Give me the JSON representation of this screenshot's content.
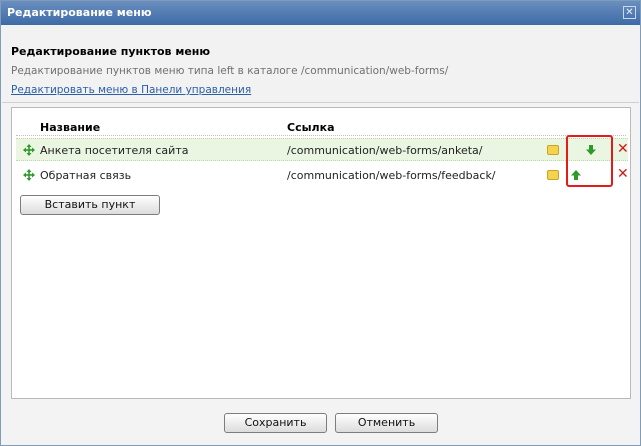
{
  "dialog": {
    "title": "Редактирование меню",
    "close_glyph": "✕"
  },
  "header": {
    "title": "Редактирование пунктов меню",
    "description": "Редактирование пунктов меню типа left в каталоге /communication/web-forms/",
    "link": "Редактировать меню в Панели управления"
  },
  "table": {
    "columns": [
      "Название",
      "Ссылка"
    ],
    "rows": [
      {
        "name": "Анкета посетителя сайта",
        "link": "/communication/web-forms/anketa/",
        "arrow": "down"
      },
      {
        "name": "Обратная связь",
        "link": "/communication/web-forms/feedback/",
        "arrow": "up"
      }
    ],
    "insert_button": "Вставить пункт",
    "delete_glyph": "✕"
  },
  "footer": {
    "save_label": "Сохранить",
    "cancel_label": "Отменить"
  },
  "colors": {
    "titlebar": "#3d6aa6",
    "highlight": "#e41b1b",
    "arrow": "#2e9a2a",
    "delete": "#d01a1a",
    "selected_row": "#eaf5e2"
  }
}
